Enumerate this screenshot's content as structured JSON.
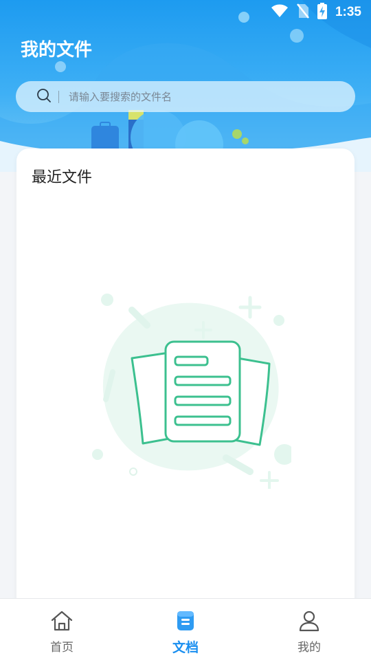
{
  "status_bar": {
    "time": "1:35",
    "icons": [
      "wifi-icon",
      "no-sim-icon",
      "battery-charging-icon"
    ]
  },
  "header": {
    "title": "我的文件"
  },
  "search": {
    "placeholder": "请输入要搜索的文件名",
    "icon": "search-icon"
  },
  "recent": {
    "title": "最近文件",
    "empty_illustration": "empty-files-illustration"
  },
  "tabs": [
    {
      "label": "首页",
      "icon": "home-icon",
      "active": false
    },
    {
      "label": "文档",
      "icon": "document-icon",
      "active": true
    },
    {
      "label": "我的",
      "icon": "user-icon",
      "active": false
    }
  ],
  "colors": {
    "header_blue": "#1d9bf0",
    "accent": "#1a8ff0",
    "illustration_green": "#3cc08f"
  }
}
